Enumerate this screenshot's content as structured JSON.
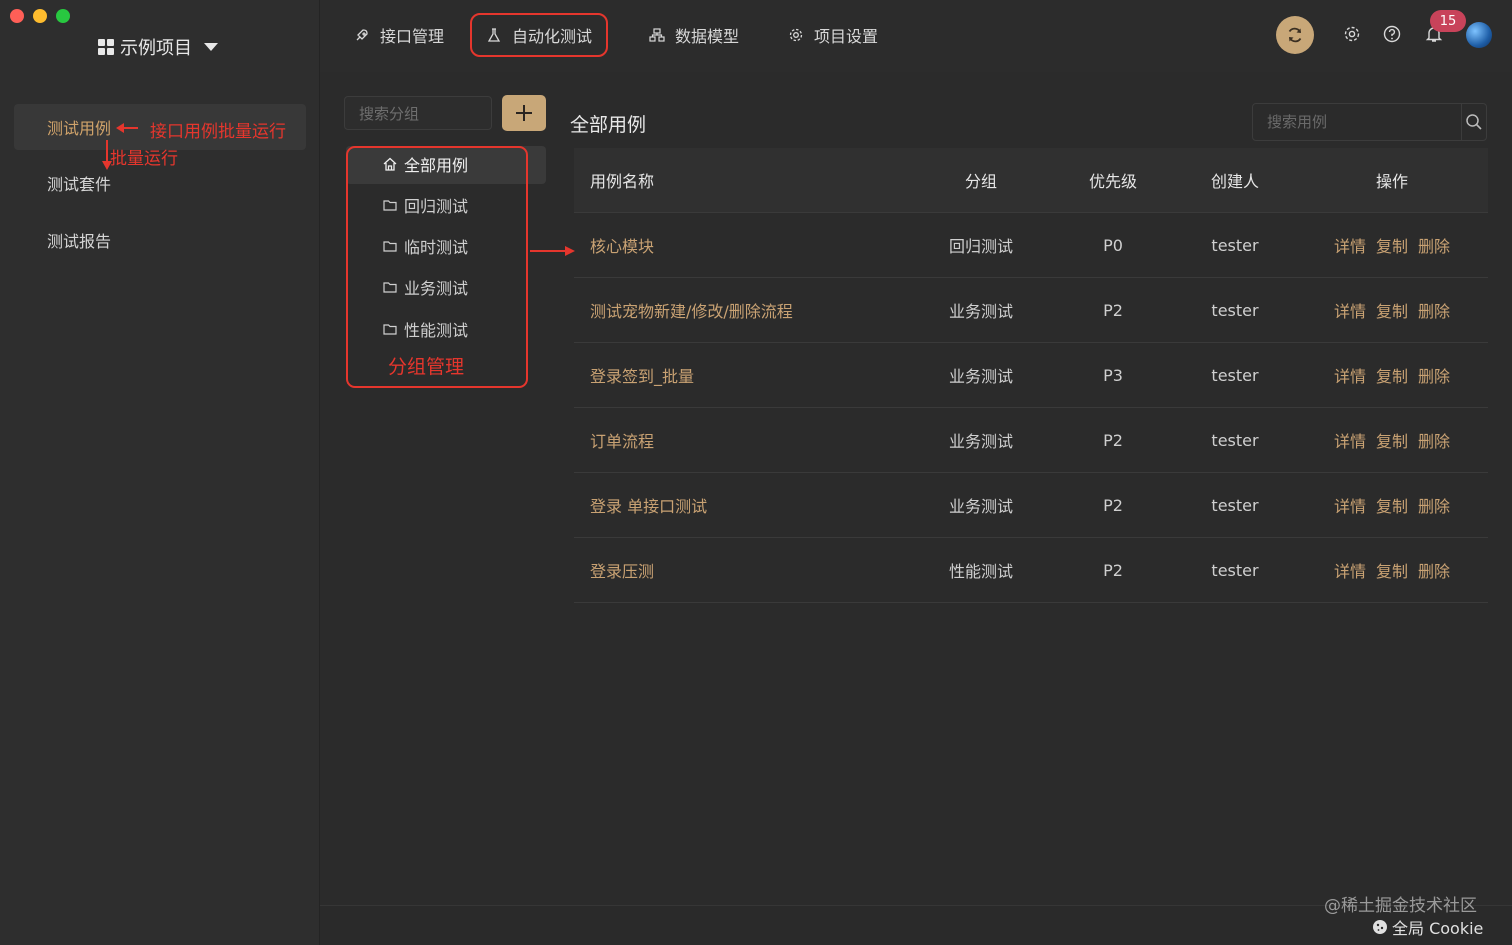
{
  "window": {
    "controls": [
      "close",
      "minimize",
      "maximize"
    ]
  },
  "sidebar": {
    "project": "示例项目",
    "items": [
      {
        "label": "测试用例",
        "active": true
      },
      {
        "label": "测试套件",
        "active": false
      },
      {
        "label": "测试报告",
        "active": false
      }
    ]
  },
  "annotations": {
    "batch_run_arrow": "接口用例批量运行",
    "batch_run": "批量运行",
    "group_manage": "分组管理"
  },
  "topnav": {
    "tabs": [
      {
        "label": "接口管理",
        "icon": "rocket-icon",
        "active": false
      },
      {
        "label": "自动化测试",
        "icon": "flask-icon",
        "active": true
      },
      {
        "label": "数据模型",
        "icon": "hierarchy-icon",
        "active": false
      },
      {
        "label": "项目设置",
        "icon": "gear-icon",
        "active": false
      }
    ],
    "notifications": "15"
  },
  "groups": {
    "search_placeholder": "搜索分组",
    "items": [
      {
        "label": "全部用例",
        "icon": "home-icon",
        "active": true
      },
      {
        "label": "回归测试",
        "icon": "folder-icon"
      },
      {
        "label": "临时测试",
        "icon": "folder-icon"
      },
      {
        "label": "业务测试",
        "icon": "folder-icon"
      },
      {
        "label": "性能测试",
        "icon": "folder-icon"
      }
    ]
  },
  "main": {
    "title": "全部用例",
    "search_placeholder": "搜索用例",
    "columns": [
      "用例名称",
      "分组",
      "优先级",
      "创建人",
      "操作"
    ],
    "rows": [
      {
        "name": "核心模块",
        "group": "回归测试",
        "priority": "P0",
        "creator": "tester"
      },
      {
        "name": "测试宠物新建/修改/删除流程",
        "group": "业务测试",
        "priority": "P2",
        "creator": "tester"
      },
      {
        "name": "登录签到_批量",
        "group": "业务测试",
        "priority": "P3",
        "creator": "tester"
      },
      {
        "name": "订单流程",
        "group": "业务测试",
        "priority": "P2",
        "creator": "tester"
      },
      {
        "name": "登录 单接口测试",
        "group": "业务测试",
        "priority": "P2",
        "creator": "tester"
      },
      {
        "name": "登录压测",
        "group": "性能测试",
        "priority": "P2",
        "creator": "tester"
      }
    ],
    "actions": [
      "详情",
      "复制",
      "删除"
    ]
  },
  "footer": {
    "watermark": "@稀土掘金技术社区",
    "cookie": "全局 Cookie"
  },
  "colors": {
    "accent": "#c9a273",
    "annotation": "#e5362d",
    "badge": "#c8435a"
  }
}
